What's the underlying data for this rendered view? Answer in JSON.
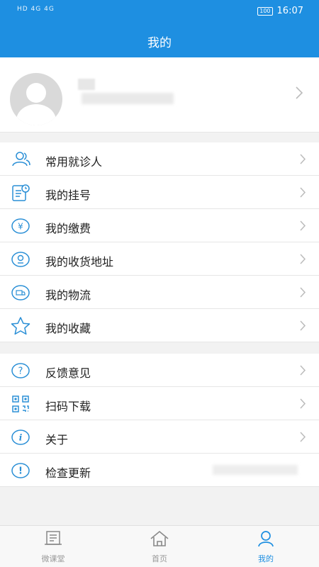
{
  "status": {
    "left_text": "HD 4G 4G",
    "battery": "100",
    "time": "16:07"
  },
  "appbar": {
    "title": "我的"
  },
  "profile": {
    "chevron": "›"
  },
  "menu_group1": [
    {
      "label": "常用就诊人",
      "icon": "people-icon"
    },
    {
      "label": "我的挂号",
      "icon": "register-icon"
    },
    {
      "label": "我的缴费",
      "icon": "yen-icon"
    },
    {
      "label": "我的收货地址",
      "icon": "location-icon"
    },
    {
      "label": "我的物流",
      "icon": "truck-icon"
    },
    {
      "label": "我的收藏",
      "icon": "star-icon"
    }
  ],
  "menu_group2": [
    {
      "label": "反馈意见",
      "icon": "question-icon"
    },
    {
      "label": "扫码下载",
      "icon": "qr-icon"
    },
    {
      "label": "关于",
      "icon": "info-icon"
    },
    {
      "label": "检查更新",
      "icon": "exclamation-icon"
    }
  ],
  "tabs": [
    {
      "label": "微课堂",
      "icon": "news-icon",
      "active": false
    },
    {
      "label": "首页",
      "icon": "home-icon",
      "active": false
    },
    {
      "label": "我的",
      "icon": "user-icon",
      "active": true
    }
  ],
  "colors": {
    "primary": "#1e8fe1",
    "icon_blue": "#2a8fd6"
  }
}
